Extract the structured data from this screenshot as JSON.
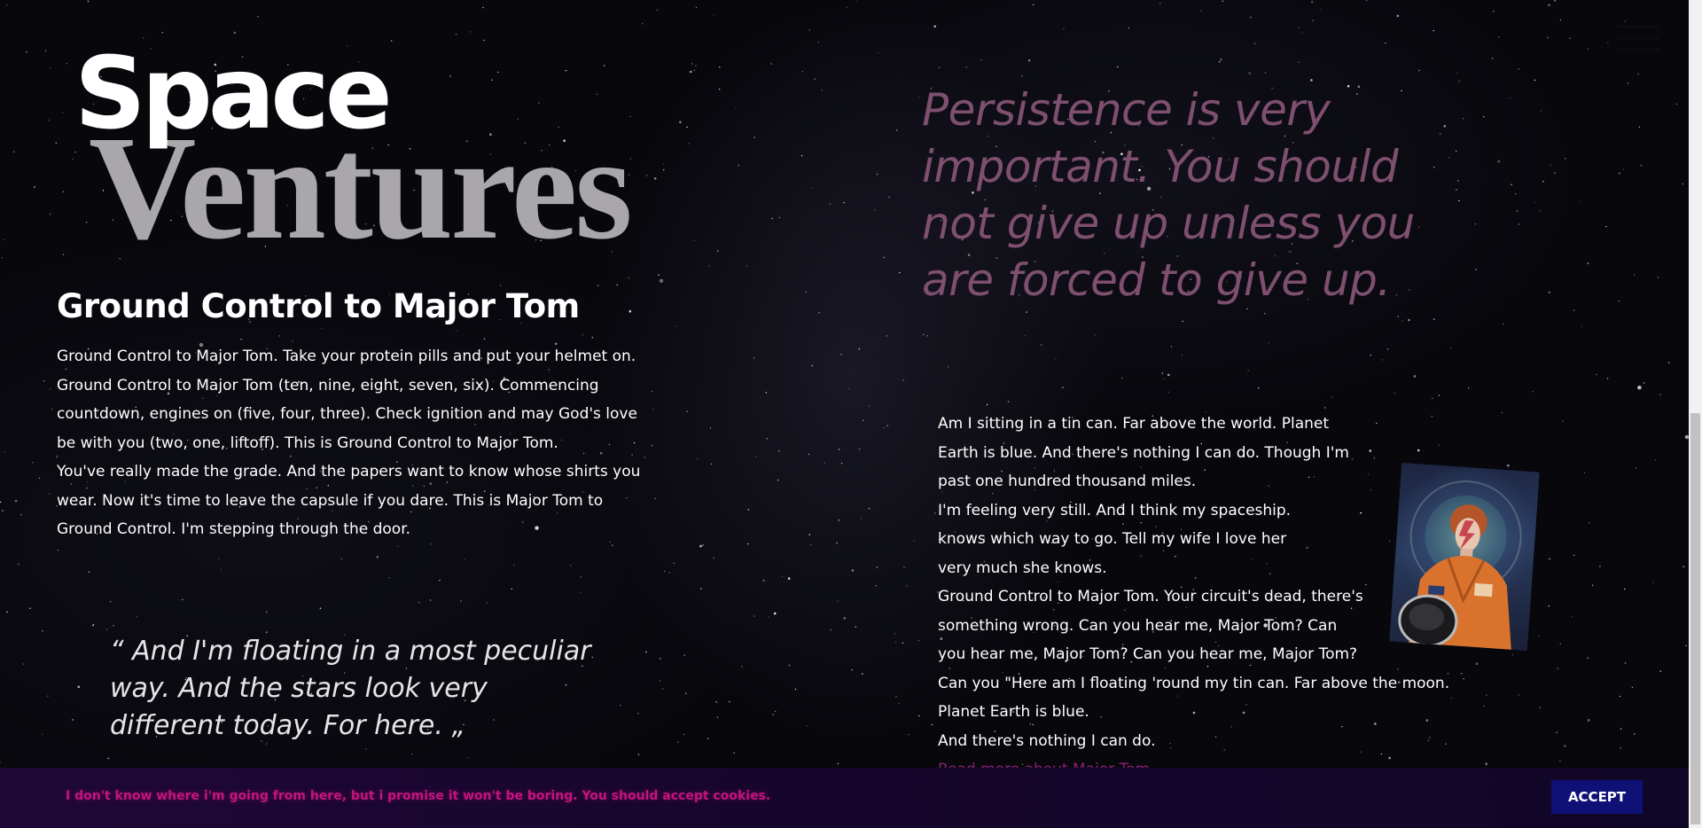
{
  "logo": {
    "line1": "Space",
    "line2": "Ventures"
  },
  "heading": "Ground Control to Major Tom",
  "body_paragraphs": [
    "Ground Control to Major Tom. Take your protein pills and put your helmet on. Ground Control to Major Tom (ten, nine, eight, seven, six). Commencing countdown, engines on (five, four, three). Check ignition and may God's love be with you (two, one, liftoff). This is Ground Control to Major Tom.",
    "You've really made the grade. And the papers want to know whose shirts you wear. Now it's time to leave the capsule if you dare. This is Major Tom to Ground Control. I'm stepping through the door."
  ],
  "quote_left": "“ And I'm floating in a most peculiar way. And the stars look very different today. For here. „",
  "quote_right": "Persistence is very important. You should not give up unless you are forced to give up.",
  "right_lines": [
    "Am I sitting in a tin can. Far above the world. Planet",
    "Earth is blue. And there's nothing I can do. Though I'm",
    "past one hundred thousand miles.",
    "I'm feeling very still. And I think my spaceship.",
    "knows which way to go. Tell my wife I love her",
    "very much she knows.",
    "Ground Control to Major Tom. Your circuit's dead, there's",
    "something wrong. Can you hear me, Major Tom? Can",
    "you hear me, Major Tom? Can you hear me, Major Tom?",
    "Can you \"Here am I floating 'round my tin can. Far above the moon.",
    "Planet Earth is blue.",
    "And there's nothing I can do."
  ],
  "read_more_link": "Read more about Major Tom",
  "cookie": {
    "text": "I don't know where i'm going from here, but i promise it won't be boring. You should accept cookies.",
    "accept_label": "ACCEPT"
  },
  "icons": {
    "menu": "hamburger-menu-icon",
    "image": "astronaut-image"
  },
  "colors": {
    "quote_accent": "#7e4f6f",
    "link": "#8c1f73",
    "cookie_text": "#c4147e",
    "accept_button": "#101177",
    "cookie_bar": "#1a0730"
  }
}
